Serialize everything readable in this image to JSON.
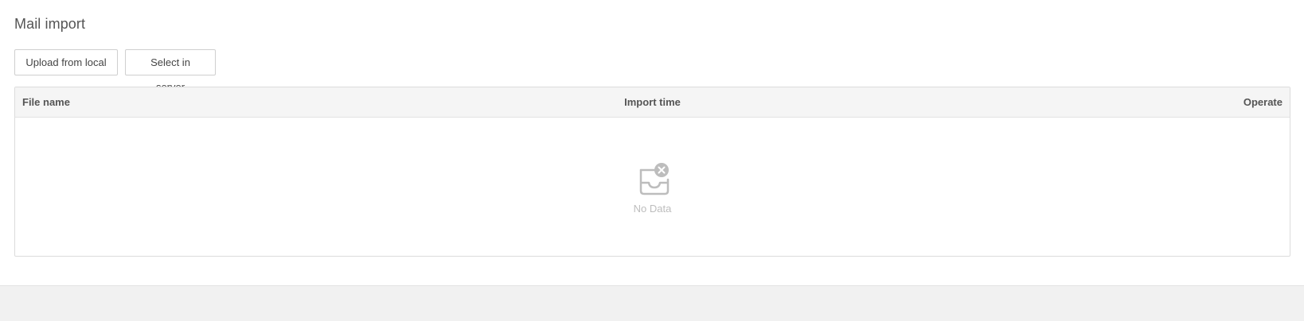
{
  "page": {
    "title": "Mail import"
  },
  "toolbar": {
    "upload_label": "Upload from local",
    "server_label": "Select in server"
  },
  "table": {
    "columns": [
      "File name",
      "Import time",
      "Operate"
    ],
    "rows": [],
    "empty_text": "No Data",
    "empty_icon": "empty-inbox-icon"
  },
  "colors": {
    "header_bg": "#f5f5f5",
    "border": "#dcdcdc",
    "footer_bg": "#f1f1f1",
    "icon_gray": "#bdbdbd"
  }
}
